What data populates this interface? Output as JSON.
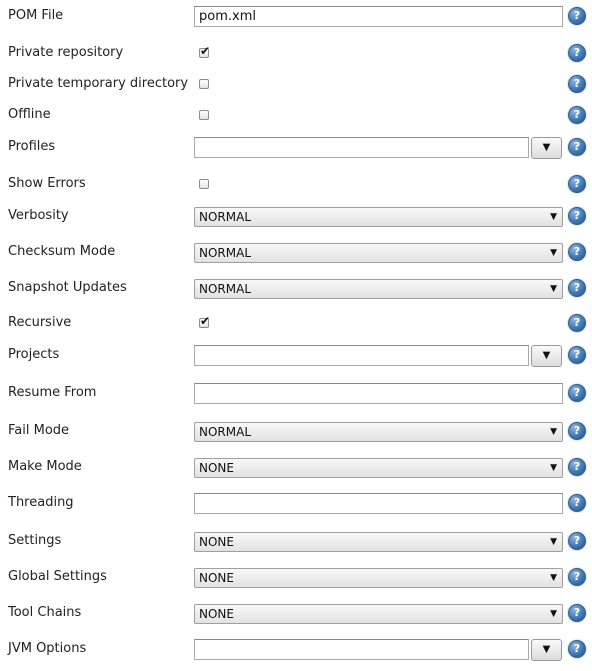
{
  "help_glyph": "?",
  "fields": {
    "pom_file": {
      "label": "POM File",
      "value": "pom.xml"
    },
    "private_repository": {
      "label": "Private repository",
      "checked": true
    },
    "private_temp_dir": {
      "label": "Private temporary directory",
      "checked": false
    },
    "offline": {
      "label": "Offline",
      "checked": false
    },
    "profiles": {
      "label": "Profiles",
      "value": ""
    },
    "show_errors": {
      "label": "Show Errors",
      "checked": false
    },
    "verbosity": {
      "label": "Verbosity",
      "value": "NORMAL"
    },
    "checksum_mode": {
      "label": "Checksum Mode",
      "value": "NORMAL"
    },
    "snapshot_updates": {
      "label": "Snapshot Updates",
      "value": "NORMAL"
    },
    "recursive": {
      "label": "Recursive",
      "checked": true
    },
    "projects": {
      "label": "Projects",
      "value": ""
    },
    "resume_from": {
      "label": "Resume From",
      "value": ""
    },
    "fail_mode": {
      "label": "Fail Mode",
      "value": "NORMAL"
    },
    "make_mode": {
      "label": "Make Mode",
      "value": "NONE"
    },
    "threading": {
      "label": "Threading",
      "value": ""
    },
    "settings": {
      "label": "Settings",
      "value": "NONE"
    },
    "global_settings": {
      "label": "Global Settings",
      "value": "NONE"
    },
    "tool_chains": {
      "label": "Tool Chains",
      "value": "NONE"
    },
    "jvm_options": {
      "label": "JVM Options",
      "value": ""
    }
  },
  "glyphs": {
    "check": "✔",
    "select_arrow": "▼",
    "dropdown_arrow": "▼"
  }
}
